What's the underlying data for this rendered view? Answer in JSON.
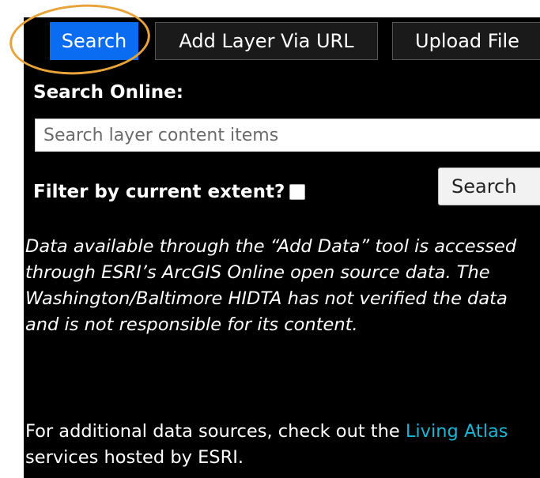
{
  "tabs": [
    {
      "label": "Search",
      "active": true
    },
    {
      "label": "Add Layer Via URL",
      "active": false
    },
    {
      "label": "Upload File",
      "active": false
    }
  ],
  "search_online": {
    "label": "Search Online:",
    "placeholder": "Search layer content items",
    "value": ""
  },
  "filter": {
    "label": "Filter by current extent?",
    "checked": false
  },
  "search_button": {
    "label": "Search"
  },
  "disclaimer": {
    "text": "Data available through the “Add Data” tool is accessed through ESRI’s ArcGIS Online open source data. The Washington/Baltimore HIDTA has not verified the data and is not responsible for its content."
  },
  "footer": {
    "prefix": "For additional data sources, check out the",
    "link_text": "Living Atlas",
    "suffix": "services hosted by ESRI."
  },
  "colors": {
    "panel_bg": "#000000",
    "active_tab": "#0a6cf0",
    "link": "#19b5d2",
    "highlight_annotation": "#e8a33a"
  }
}
